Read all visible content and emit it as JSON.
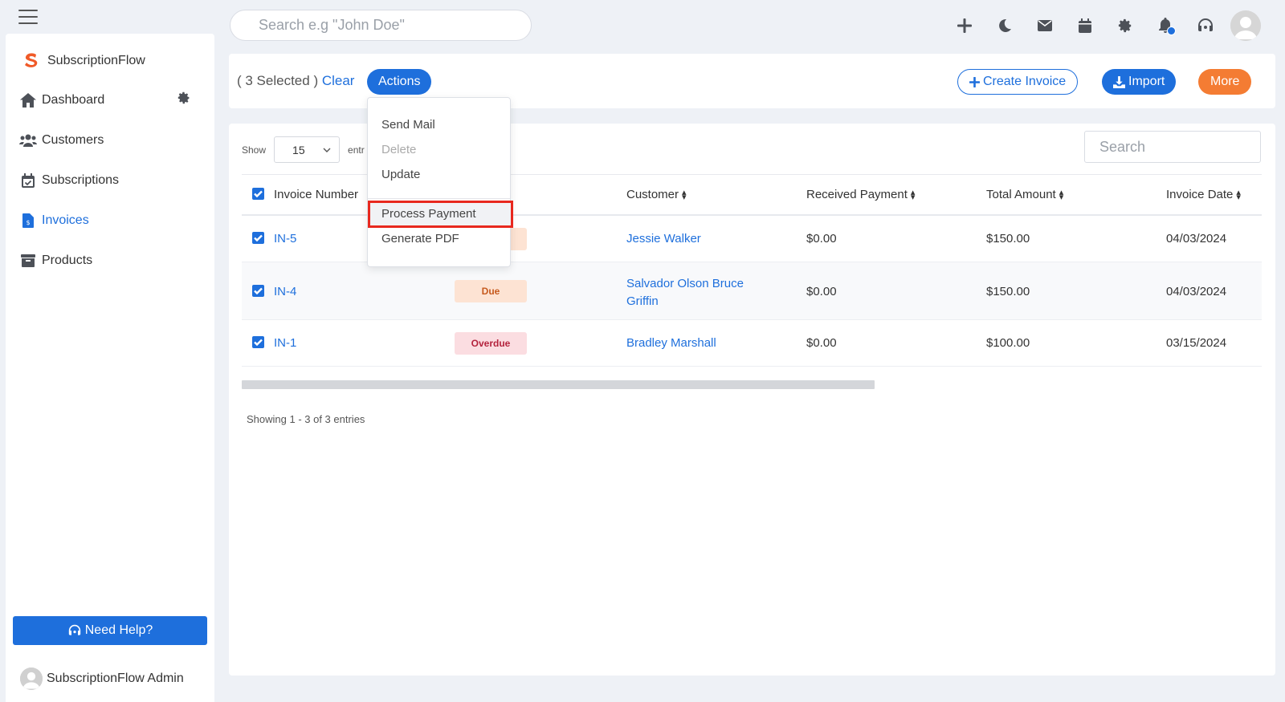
{
  "topbar": {
    "search_placeholder": "Search e.g \"John Doe\"",
    "icons": [
      "plus-icon",
      "moon-icon",
      "envelope-icon",
      "calendar-icon",
      "gear-icon",
      "bell-icon",
      "headset-icon",
      "avatar"
    ]
  },
  "sidebar": {
    "brand": "SubscriptionFlow",
    "items": [
      {
        "label": "Dashboard",
        "icon": "home-icon"
      },
      {
        "label": "Customers",
        "icon": "users-icon"
      },
      {
        "label": "Subscriptions",
        "icon": "calendar-check-icon"
      },
      {
        "label": "Invoices",
        "icon": "invoice-icon",
        "active": true
      },
      {
        "label": "Products",
        "icon": "box-icon"
      }
    ],
    "help_label": "Need Help?",
    "admin_name": "SubscriptionFlow Admin"
  },
  "actionbar": {
    "selected_text": "( 3 Selected )",
    "clear_label": "Clear",
    "actions_label": "Actions",
    "create_label": "Create Invoice",
    "import_label": "Import",
    "more_label": "More"
  },
  "dropdown": {
    "items": [
      "Send Mail",
      "Delete",
      "Update",
      "Process Payment",
      "Generate PDF"
    ]
  },
  "table": {
    "show_label": "Show",
    "page_size": "15",
    "entries_label": "entr",
    "search_placeholder": "Search",
    "columns": [
      "Invoice Number",
      "Customer",
      "Received Payment",
      "Total Amount",
      "Invoice Date"
    ],
    "rows": [
      {
        "invoice": "IN-5",
        "status": "",
        "customer": "Jessie Walker",
        "received": "$0.00",
        "total": "$150.00",
        "date": "04/03/2024"
      },
      {
        "invoice": "IN-4",
        "status": "Due",
        "customer_line1": "Salvador Olson Bruce",
        "customer_line2": "Griffin",
        "received": "$0.00",
        "total": "$150.00",
        "date": "04/03/2024"
      },
      {
        "invoice": "IN-1",
        "status": "Overdue",
        "customer": "Bradley Marshall",
        "received": "$0.00",
        "total": "$100.00",
        "date": "03/15/2024"
      }
    ],
    "footer": "Showing 1 - 3 of 3 entries"
  },
  "colors": {
    "primary": "#1e6fdc",
    "orange": "#f47c33",
    "highlight": "#e8281e"
  }
}
